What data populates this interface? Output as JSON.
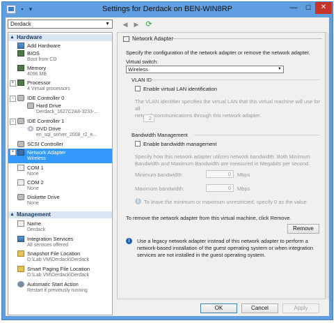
{
  "window": {
    "title": "Settings for Derdack on BEN-WIN8RP"
  },
  "controls": {
    "minimize": "—",
    "maximize": "☐",
    "close": "✕"
  },
  "vm_selector": {
    "value": "Derdack"
  },
  "tree": {
    "hardware_label": "Hardware",
    "management_label": "Management",
    "hardware": [
      {
        "label": "Add Hardware",
        "sub": ""
      },
      {
        "label": "BIOS",
        "sub": "Boot from CD"
      },
      {
        "label": "Memory",
        "sub": "4096 MB"
      },
      {
        "label": "Processor",
        "sub": "4 Virtual processors"
      },
      {
        "label": "IDE Controller 0",
        "sub": ""
      },
      {
        "label": "Hard Drive",
        "sub": "Derdack_1627C2A8-3233-..."
      },
      {
        "label": "IDE Controller 1",
        "sub": ""
      },
      {
        "label": "DVD Drive",
        "sub": "en_sql_server_2008_r2_e..."
      },
      {
        "label": "SCSI Controller",
        "sub": ""
      },
      {
        "label": "Network Adapter",
        "sub": "Wireless"
      },
      {
        "label": "COM 1",
        "sub": "None"
      },
      {
        "label": "COM 2",
        "sub": "None"
      },
      {
        "label": "Diskette Drive",
        "sub": "None"
      }
    ],
    "management": [
      {
        "label": "Name",
        "sub": "Derdack"
      },
      {
        "label": "Integration Services",
        "sub": "All services offered"
      },
      {
        "label": "Snapshot File Location",
        "sub": "D:\\Lab VM\\Derdack\\Derdack"
      },
      {
        "label": "Smart Paging File Location",
        "sub": "D:\\Lab VM\\Derdack\\Derdack"
      },
      {
        "label": "Automatic Start Action",
        "sub": "Restart if previously running"
      }
    ]
  },
  "panel": {
    "header": "Network Adapter",
    "intro": "Specify the configuration of the network adapter or remove the network adapter.",
    "virtual_switch_label": "Virtual switch:",
    "virtual_switch_value": "Wireless",
    "vlan_title": "VLAN ID",
    "vlan_checkbox_label": "Enable virtual LAN identification",
    "vlan_desc": "The VLAN identifier specifies the virtual LAN that this virtual machine will use for all\nnetwork communications through this network adapter.",
    "vlan_value": "2",
    "bw_title": "Bandwidth Management",
    "bw_checkbox_label": "Enable bandwidth management",
    "bw_desc": "Specify how this network adapter utilizes network bandwidth. Both Minimum\nBandwidth and Maximum Bandwidth are measured in Megabits per second.",
    "min_label": "Minimum bandwidth:",
    "min_value": "0",
    "max_label": "Maximum bandwidth:",
    "max_value": "0",
    "unit": "Mbps",
    "bw_note": "To leave the minimum or maximum unrestricted, specify 0 as the value.",
    "remove_text": "To remove the network adapter from this virtual machine, click Remove.",
    "remove_button": "Remove",
    "legacy_note": "Use a legacy network adapter instead of this network adapter to perform a\nnetwork-based installation of the guest operating system or when integration\nservices are not installed in the guest operating system."
  },
  "footer": {
    "ok": "OK",
    "cancel": "Cancel",
    "apply": "Apply"
  },
  "colors": {
    "titlebar": "#5f9ee0",
    "selection": "#3399ff",
    "close": "#c7352a"
  }
}
